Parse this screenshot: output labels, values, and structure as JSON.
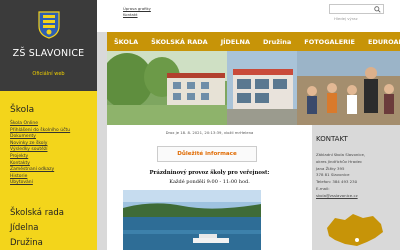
{
  "brand": {
    "school_name": "ZŠ SLAVONICE",
    "subtitle": "Oficiální web"
  },
  "header": {
    "links": [
      "Úprava grafiky",
      "Kontakt"
    ],
    "search_placeholder": "Hledej výraz"
  },
  "nav": {
    "items": [
      "ŠKOLA",
      "ŠKOLSKÁ RADA",
      "JÍDELNA",
      "Družina",
      "FOTOGALERIE",
      "EDUROAM"
    ]
  },
  "sidebar": {
    "heading": "Škola",
    "links": [
      "Škola Online",
      "Přihlášení do školního účtu",
      "Dokumenty",
      "Novinky ze školy",
      "Výsledky soutěží",
      "Projekty",
      "Kontakty",
      "Zaměstnaní odkazy",
      "Historie",
      "Ubytování"
    ],
    "sections": [
      "Školská rada",
      "Jídelna",
      "Družina"
    ]
  },
  "article": {
    "meta": "Drox je 18. 8. 2021, 20:13:39, vložil mrHelena",
    "notice": "Důležité informace",
    "hours_title": "Prázdninový provoz školy pro veřejnost:",
    "hours_text": "Každé pondělí 9:00 - 11:00 hod."
  },
  "contact": {
    "title": "KONTAKT",
    "lines": [
      "Základní škola Slavonice,",
      "okres Jindřichův Hradec",
      "Jana Žižky 395",
      "378 81 Slavonice",
      "Telefon: 384 493 230",
      "E-mail:"
    ],
    "email": "skola@zsslavonice.cz"
  },
  "colors": {
    "nav_bg": "#c79408",
    "sidebar_bg": "#f3d51b",
    "brand_bg": "#3b3b3b",
    "notice": "#e06a00"
  }
}
